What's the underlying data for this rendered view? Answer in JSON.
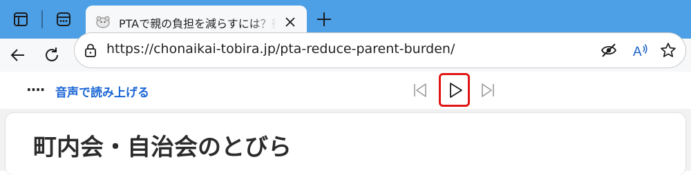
{
  "browser": {
    "tab": {
      "title": "PTAで親の負担を減らすには？行事・",
      "favicon": "mascot-favicon-icon",
      "close_icon": "close-icon"
    },
    "new_tab_icon": "plus-icon",
    "toolbar": {
      "back_icon": "back-arrow-icon",
      "refresh_icon": "refresh-icon"
    },
    "address_bar": {
      "url": "https://chonaikai-tobira.jp/pta-reduce-parent-burden/",
      "icons": [
        "lock-icon",
        "tracking-prevention-icon",
        "read-aloud-icon",
        "favorite-star-icon"
      ]
    }
  },
  "read_aloud": {
    "more_label": "····",
    "label": "音声で読み上げる",
    "controls": [
      "previous-icon",
      "play-icon",
      "next-icon"
    ],
    "highlight_color": "#e01414"
  },
  "page": {
    "title": "町内会・自治会のとびら"
  },
  "colors": {
    "titlebar": "#4da0e6",
    "link_blue": "#1a66d6"
  }
}
